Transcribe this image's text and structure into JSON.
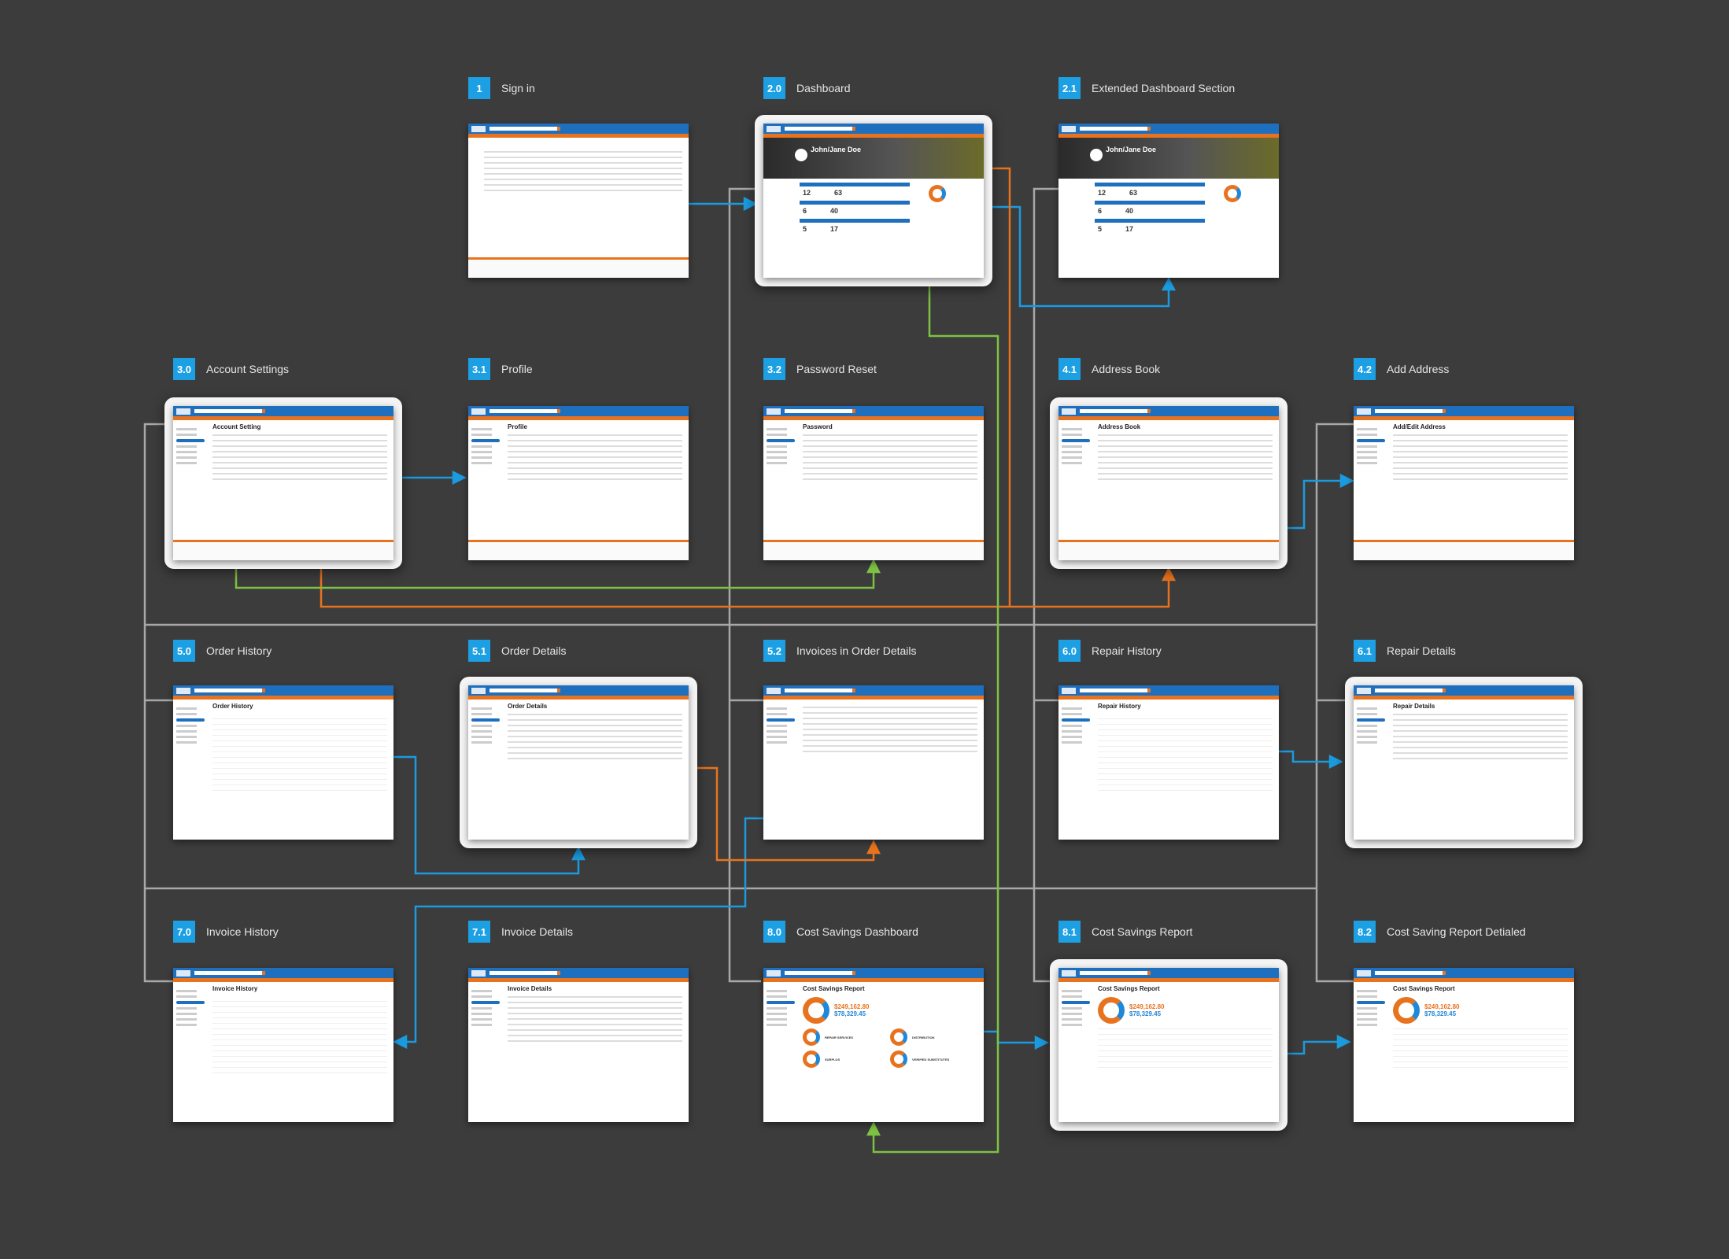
{
  "colors": {
    "background": "#3c3c3c",
    "badge": "#1ca0e3",
    "header": "#1f6fbf",
    "accent": "#e8731f",
    "link_blue": "#1a9be0",
    "link_orange": "#e8731f",
    "link_green": "#7dc242",
    "link_gray": "#a8a8a8"
  },
  "screens": [
    {
      "id": "1",
      "label": "Sign in",
      "title": "",
      "kind": "signin"
    },
    {
      "id": "2.0",
      "label": "Dashboard",
      "title": "John/Jane Doe",
      "kind": "dash",
      "highlight": true
    },
    {
      "id": "2.1",
      "label": "Extended Dashboard Section",
      "title": "John/Jane Doe",
      "kind": "dash"
    },
    {
      "id": "3.0",
      "label": "Account Settings",
      "title": "Account Setting",
      "kind": "form",
      "highlight": true
    },
    {
      "id": "3.1",
      "label": "Profile",
      "title": "Profile",
      "kind": "form"
    },
    {
      "id": "3.2",
      "label": "Password Reset",
      "title": "Password",
      "kind": "form"
    },
    {
      "id": "4.1",
      "label": "Address Book",
      "title": "Address Book",
      "kind": "form",
      "highlight": true
    },
    {
      "id": "4.2",
      "label": "Add Address",
      "title": "Add/Edit Address",
      "kind": "form"
    },
    {
      "id": "5.0",
      "label": "Order History",
      "title": "Order History",
      "kind": "table"
    },
    {
      "id": "5.1",
      "label": "Order Details",
      "title": "Order Details",
      "kind": "detail",
      "highlight": true
    },
    {
      "id": "5.2",
      "label": "Invoices in Order Details",
      "title": "",
      "kind": "detail"
    },
    {
      "id": "6.0",
      "label": "Repair History",
      "title": "Repair History",
      "kind": "table"
    },
    {
      "id": "6.1",
      "label": "Repair Details",
      "title": "Repair Details",
      "kind": "detail",
      "highlight": true
    },
    {
      "id": "7.0",
      "label": "Invoice History",
      "title": "Invoice History",
      "kind": "table"
    },
    {
      "id": "7.1",
      "label": "Invoice Details",
      "title": "Invoice Details",
      "kind": "detail"
    },
    {
      "id": "8.0",
      "label": "Cost Savings Dashboard",
      "title": "Cost Savings Report",
      "kind": "cost"
    },
    {
      "id": "8.1",
      "label": "Cost Savings Report",
      "title": "Cost Savings Report",
      "kind": "report",
      "highlight": true
    },
    {
      "id": "8.2",
      "label": "Cost Saving Report Detialed",
      "title": "Cost Savings Report",
      "kind": "report"
    }
  ],
  "dashboard": {
    "kpis": [
      "12",
      "63",
      "6",
      "40",
      "5",
      "17"
    ]
  },
  "cost": {
    "total_savings": "$249,162.80",
    "total_spent": "$78,329.45",
    "groups": [
      "REPAIR SERVICES",
      "DISTRIBUTION",
      "SURPLUS",
      "VERIFIED SUBSTITUTES"
    ]
  }
}
